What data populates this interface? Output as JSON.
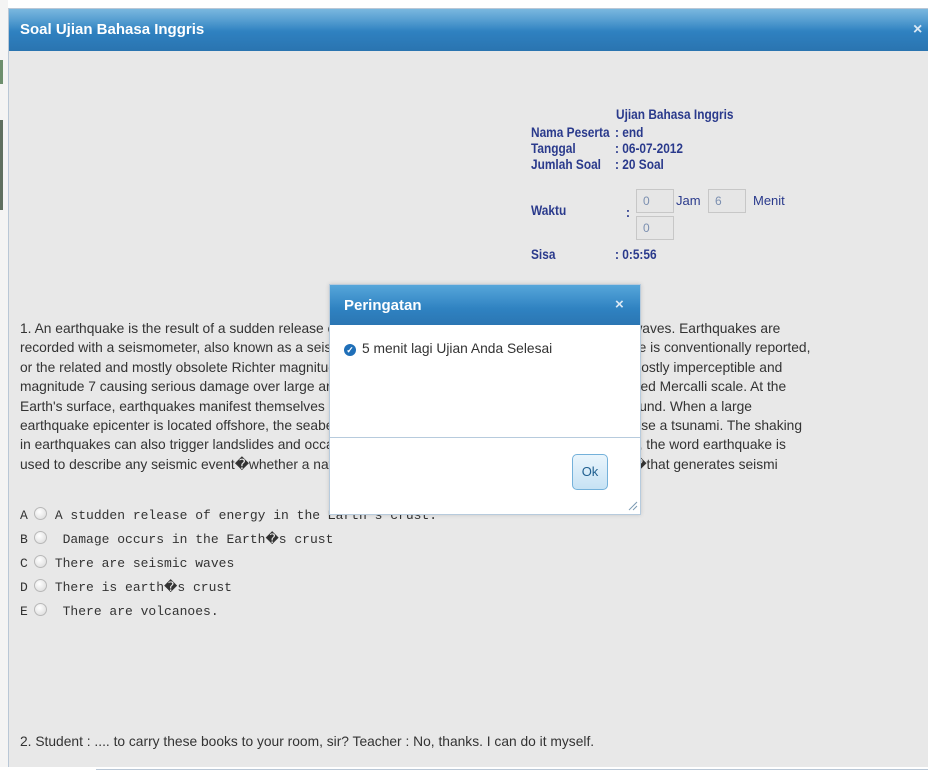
{
  "window": {
    "title": "Soal Ujian Bahasa Inggris",
    "close_glyph": "×",
    "accent": "#2f81c0"
  },
  "exam_info": {
    "heading": "Ujian Bahasa Inggris",
    "peserta_label": "Nama Peserta",
    "peserta_value": ": end",
    "tanggal_label": "Tanggal",
    "tanggal_value": ": 06-07-2012",
    "jumlah_label": "Jumlah Soal",
    "jumlah_value": ": 20 Soal",
    "waktu_label": "Waktu",
    "waktu_colon": ":",
    "jam_value": "0",
    "jam_unit": "Jam",
    "menit_value": "6",
    "menit_unit": "Menit",
    "detik_value": "0",
    "sisa_label": "Sisa",
    "sisa_value": ": 0:5:56"
  },
  "question1": {
    "lines": [
      "1. An earthquake is the result of a sudden release of energy in the Earth's crust that creates seismic waves. Earthquakes are",
      "recorded with a seismometer, also known as a seismograph. The moment magnitude of an earthquake is conventionally reported,",
      "or the related and mostly obsolete Richter magnitude, with magnitude 3 or lower earthquakes being mostly imperceptible and",
      "magnitude 7 causing serious damage over large areas. Intensity of shaking is measured on the modified Mercalli scale. At the",
      "Earth's surface, earthquakes manifest themselves by shaking and sometimes displacement of the ground. When a large",
      "earthquake epicenter is located offshore, the seabed sometimes suffers sufficient displacement to cause a tsunami. The shaking",
      "in earthquakes can also trigger landslides and occasionally volcanic activity. In its most generic sense, the word earthquake is",
      "used to describe any seismic event�whether a natural phenomenon or an event caused by humans�that generates seismi"
    ],
    "options": [
      {
        "letter": "A",
        "text": "A studden release of energy in the Earth's crust."
      },
      {
        "letter": "B",
        "text": " Damage occurs in the Earth�s crust"
      },
      {
        "letter": "C",
        "text": "There are seismic waves"
      },
      {
        "letter": "D",
        "text": "There is earth�s crust"
      },
      {
        "letter": "E",
        "text": " There are volcanoes."
      }
    ]
  },
  "question2": {
    "text": "2. Student : .... to carry these books to your room, sir? Teacher : No, thanks. I can do it myself."
  },
  "dialog": {
    "title": "Peringatan",
    "close_glyph": "×",
    "icon": "check-circle-icon",
    "message": "5 menit lagi Ujian Anda Selesai",
    "ok_label": "Ok"
  }
}
